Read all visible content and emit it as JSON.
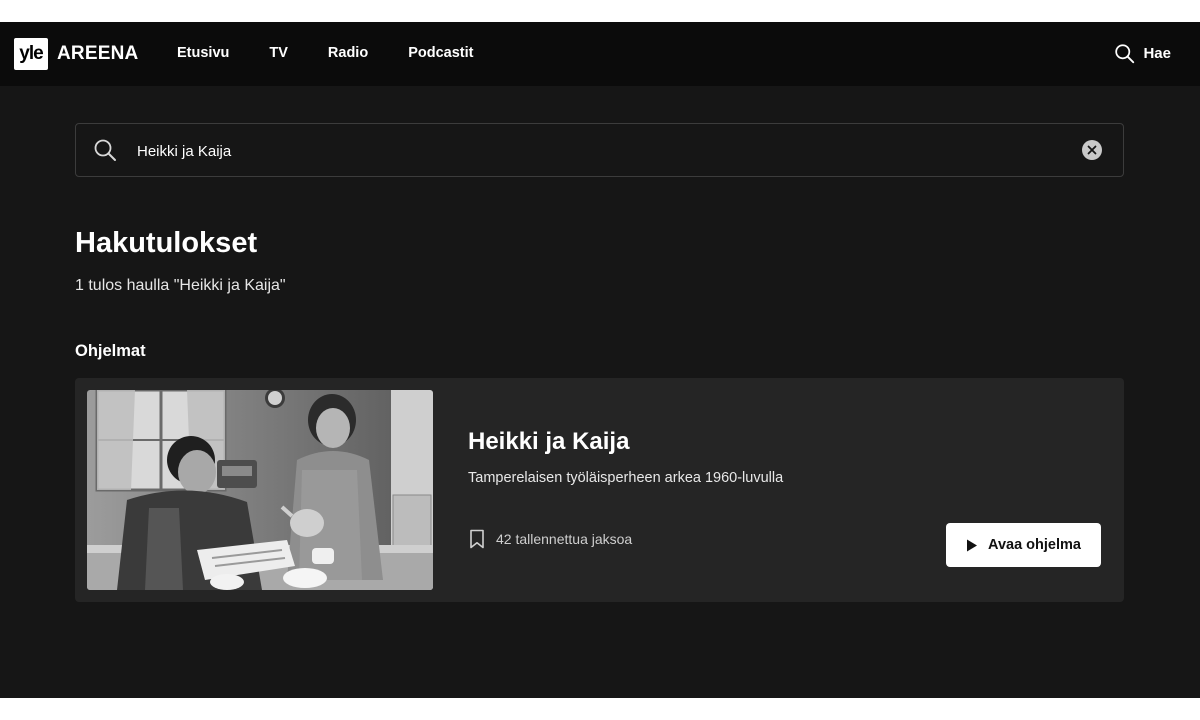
{
  "brand": {
    "logo_text": "yle",
    "name": "AREENA"
  },
  "nav": {
    "items": [
      {
        "label": "Etusivu"
      },
      {
        "label": "TV"
      },
      {
        "label": "Radio"
      },
      {
        "label": "Podcastit"
      }
    ],
    "search_label": "Hae",
    "search_icon": "search-icon"
  },
  "search": {
    "value": "Heikki ja Kaija",
    "placeholder": "",
    "clear_icon": "close-icon"
  },
  "results": {
    "title": "Hakutulokset",
    "count_text": "1 tulos haulla \"Heikki ja Kaija\"",
    "section_title": "Ohjelmat",
    "items": [
      {
        "title": "Heikki ja Kaija",
        "description": "Tamperelaisen työläisperheen arkea 1960-luvulla",
        "saved_episodes": "42 tallennettua jaksoa",
        "meta_icon": "bookmark-icon",
        "action_label": "Avaa ohjelma",
        "action_icon": "play-icon"
      }
    ]
  },
  "colors": {
    "page_background": "#161616",
    "nav_background": "#0b0b0b",
    "card_background": "#252525",
    "button_background": "#ffffff"
  }
}
